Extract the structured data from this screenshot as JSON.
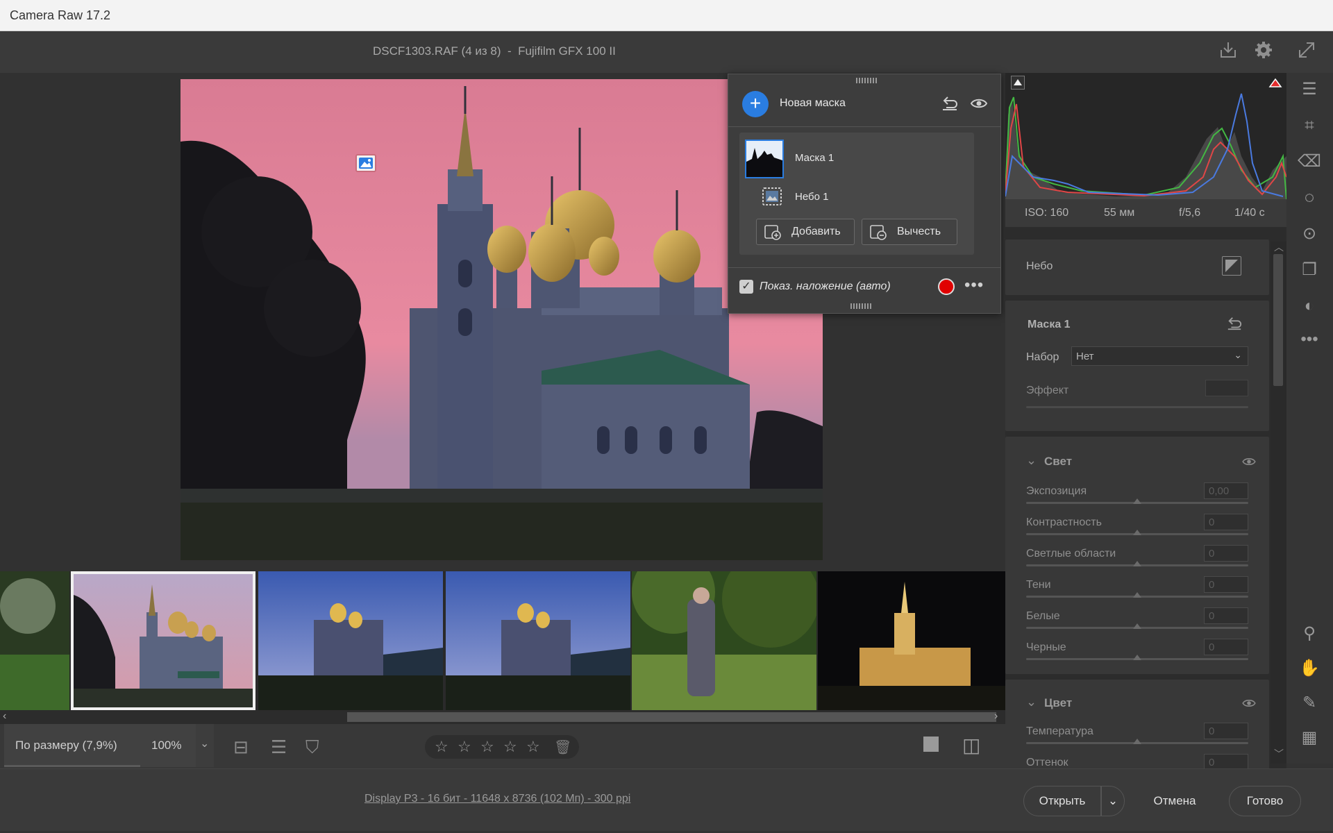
{
  "window": {
    "title": "Camera Raw 17.2"
  },
  "header": {
    "doc_title": "DSCF1303.RAF (4 из 8)  -  Fujifilm GFX 100 II"
  },
  "icons": {
    "save": "download-icon",
    "settings": "gear-icon",
    "fullscreen": "expand-icon",
    "undo": "undo-icon",
    "eye": "eye-icon",
    "more": "more-icon"
  },
  "masks_panel": {
    "new_mask_label": "Новая маска",
    "items": [
      {
        "label": "Маска 1"
      },
      {
        "label": "Небо 1"
      }
    ],
    "add_label": "Добавить",
    "subtract_label": "Вычесть",
    "overlay_label": "Показ. наложение (авто)",
    "overlay_checked": true,
    "overlay_color": "#e00000"
  },
  "exif": {
    "iso": "ISO: 160",
    "focal": "55 мм",
    "aperture": "f/5,6",
    "shutter": "1/40 с"
  },
  "right_panel": {
    "sky_label": "Небо",
    "mask_title": "Маска 1",
    "preset_label": "Набор",
    "preset_value": "Нет",
    "effect_label": "Эффект",
    "light": {
      "title": "Свет",
      "sliders": [
        {
          "label": "Экспозиция",
          "value": "0,00"
        },
        {
          "label": "Контрастность",
          "value": "0"
        },
        {
          "label": "Светлые области",
          "value": "0"
        },
        {
          "label": "Тени",
          "value": "0"
        },
        {
          "label": "Белые",
          "value": "0"
        },
        {
          "label": "Черные",
          "value": "0"
        }
      ]
    },
    "color": {
      "title": "Цвет",
      "sliders": [
        {
          "label": "Температура",
          "value": "0"
        },
        {
          "label": "Оттенок",
          "value": "0"
        }
      ]
    }
  },
  "bottom_bar": {
    "fit_label": "По размеру (7,9%)",
    "zoom_label": "100%",
    "rating_stars": 5
  },
  "status": {
    "info": "Display P3 - 16 бит - 11648 x 8736 (102 Мп) - 300 ppi",
    "open_label": "Открыть",
    "cancel_label": "Отмена",
    "done_label": "Готово"
  },
  "accent_color": "#2a7de1"
}
